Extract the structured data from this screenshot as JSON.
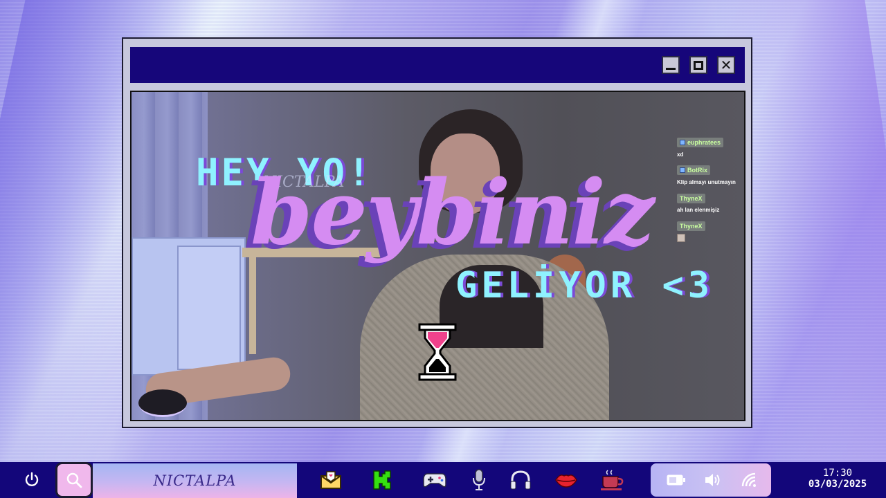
{
  "overlay": {
    "greeting": "HEY YO!",
    "headline": "beybiniz",
    "subline": "GELİYOR <3",
    "watermark": "NICTALPA"
  },
  "chat": {
    "messages": [
      {
        "user": "euphratees",
        "text": "xd"
      },
      {
        "user": "BotRix",
        "text": "Klip almayı unutmayın"
      },
      {
        "user": "ThyneX",
        "text": "ah lan elenmişiz"
      },
      {
        "user": "ThyneX",
        "text": ""
      }
    ]
  },
  "window": {
    "title": "",
    "minimize_icon": "minimize-icon",
    "maximize_icon": "maximize-icon",
    "close_icon": "close-icon"
  },
  "taskbar": {
    "brand": "NICTALPA",
    "apps": [
      "mail-icon",
      "kick-icon",
      "gamepad-icon",
      "microphone-icon",
      "headphones-icon",
      "lips-icon",
      "coffee-cup-icon"
    ],
    "tray": [
      "battery-icon",
      "volume-icon",
      "wifi-icon"
    ],
    "time": "17:30",
    "date": "03/03/2025"
  },
  "colors": {
    "titlebar": "#16067a",
    "taskbar": "#13067a",
    "accent_cyan": "#8ff2ff",
    "accent_pink": "#d58cf2"
  }
}
